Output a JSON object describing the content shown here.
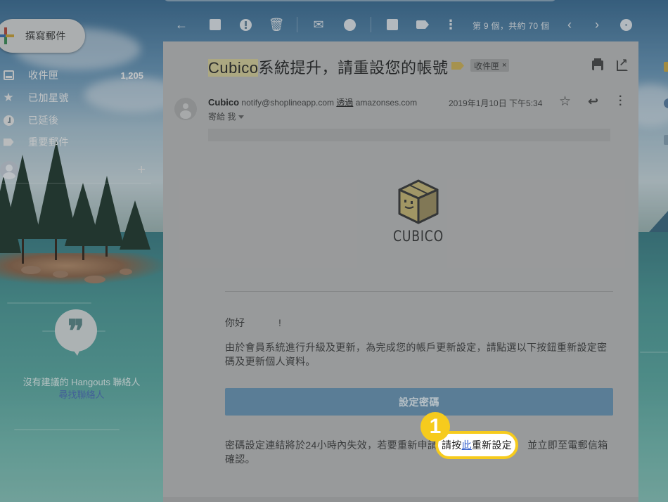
{
  "nav": {
    "compose_label": "撰寫郵件",
    "items": [
      {
        "label": "收件匣",
        "count": "1,205",
        "icon": "inbox-icon"
      },
      {
        "label": "已加星號",
        "count": "",
        "icon": "star-icon"
      },
      {
        "label": "已延後",
        "count": "",
        "icon": "clock-icon"
      },
      {
        "label": "重要郵件",
        "count": "",
        "icon": "label-important-icon"
      }
    ],
    "add_hangout": "+",
    "hangouts_empty_line1": "沒有建議的 Hangouts 聯絡人",
    "hangouts_empty_link": "尋找聯絡人"
  },
  "toolbar": {
    "pager_text": "第 9 個，共約 70 個",
    "icons": [
      "back-arrow-icon",
      "archive-icon",
      "report-spam-icon",
      "delete-icon",
      "mark-unread-icon",
      "snooze-icon",
      "move-to-icon",
      "labels-icon",
      "more-icon",
      "prev-icon",
      "next-icon",
      "settings-icon"
    ]
  },
  "email": {
    "subject_highlight": "Cubico",
    "subject_rest": "系統提升，請重設您的帳號",
    "label_chip": "收件匣",
    "label_chip_close": "×",
    "sender_name": "Cubico",
    "sender_address": "notify@shoplineapp.com",
    "via_label": "透過",
    "via_domain": "amazonses.com",
    "to_line": "寄給 我",
    "date": "2019年1月10日 下午5:34",
    "logo_text": "CUBICO",
    "greeting": "你好",
    "greeting_mark": "!",
    "body_paragraph": "由於會員系統進行升級及更新，為完成您的帳戶更新設定，請點選以下按鈕重新設定密碼及更新個人資料。",
    "cta_label": "設定密碼",
    "note_before": "密碼設定連結將於24小時內失效，若要重新申請",
    "note_after": "並立即至電郵信箱確認。"
  },
  "callout": {
    "step_number": "1",
    "text_before": "請按",
    "link_text": "此",
    "text_after": "重新設定",
    "color": "#f6cb1d"
  }
}
